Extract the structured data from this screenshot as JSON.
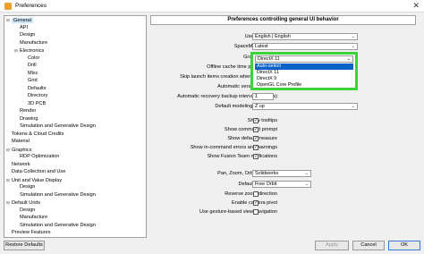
{
  "window": {
    "title": "Preferences"
  },
  "tree": [
    {
      "label": "General",
      "toggle": "−",
      "selected": true
    },
    {
      "label": "API"
    },
    {
      "label": "Design"
    },
    {
      "label": "Manufacture"
    },
    {
      "label": "Electronics",
      "toggle": "−"
    },
    {
      "label": "Color"
    },
    {
      "label": "Drill"
    },
    {
      "label": "Misc"
    },
    {
      "label": "Grid"
    },
    {
      "label": "Defaults"
    },
    {
      "label": "Directory"
    },
    {
      "label": "3D PCB"
    },
    {
      "label": "Render"
    },
    {
      "label": "Drawing"
    },
    {
      "label": "Simulation and Generative Design"
    },
    {
      "label": "Tokens & Cloud Credits"
    },
    {
      "label": "Material"
    },
    {
      "label": "Graphics",
      "toggle": "−"
    },
    {
      "label": "RDP Optimization"
    },
    {
      "label": "Network"
    },
    {
      "label": "Data Collection and Use"
    },
    {
      "label": "Unit and Value Display",
      "toggle": "−"
    },
    {
      "label": "Design"
    },
    {
      "label": "Simulation and Generative Design"
    },
    {
      "label": "Default Units",
      "toggle": "−"
    },
    {
      "label": "Design"
    },
    {
      "label": "Manufacture"
    },
    {
      "label": "Simulation and Generative Design"
    },
    {
      "label": "Preview Features"
    }
  ],
  "panel": {
    "header": "Preferences controlling general UI behavior",
    "user_language_label": "User language",
    "user_language_value": "English | English",
    "spacemouse_label": "SpaceMouse driver",
    "spacemouse_value": "Latest",
    "graphics_driver_label": "Graphics driver",
    "graphics_driver_value": "DirectX 11",
    "graphics_options": [
      "Auto-select",
      "DirectX 11",
      "DirectX 9",
      "OpenGL Core Profile"
    ],
    "offline_cache_label": "Offline cache time period (days)",
    "skip_launch_label": "Skip launch items creation when live update",
    "auto_version_label": "Automatic version on close",
    "auto_recovery_label": "Automatic recovery backup interval (minutes)",
    "auto_recovery_value": "1",
    "default_orientation_label": "Default modeling orientation",
    "default_orientation_value": "Z up",
    "show_tooltips_label": "Show tooltips",
    "show_command_prompt_label": "Show command prompt",
    "show_default_measure_label": "Show default measure",
    "show_incommand_errors_label": "Show in-command errors and warnings",
    "show_fusion_team_label": "Show Fusion Team notifications",
    "pan_zoom_label": "Pan, Zoom, Orbit shortcuts",
    "pan_zoom_value": "Solidworks",
    "default_orbit_label": "Default Orbit type",
    "default_orbit_value": "Free Orbit",
    "reverse_zoom_label": "Reverse zoom direction",
    "enable_camera_pivot_label": "Enable camera pivot",
    "gesture_nav_label": "Use gesture-based view navigation"
  },
  "footer": {
    "restore_defaults": "Restore Defaults",
    "apply": "Apply",
    "cancel": "Cancel",
    "ok": "OK"
  },
  "colors": {
    "highlight_border": "#3ad33a",
    "selection_blue": "#0a62c8"
  }
}
